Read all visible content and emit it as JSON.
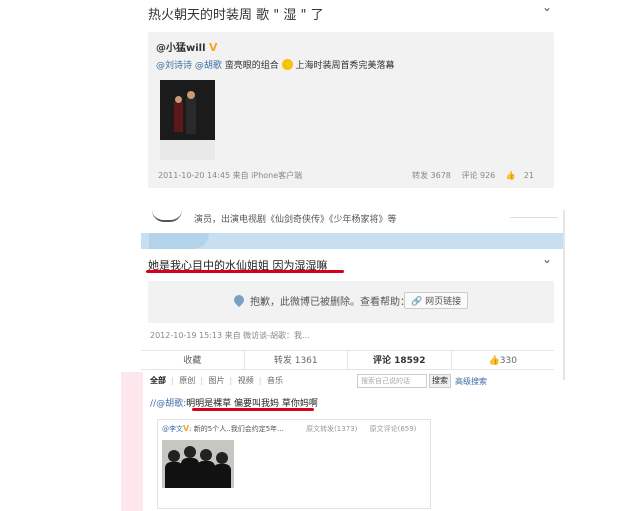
{
  "post1": {
    "text": "热火朝天的时装周 歌 \" 湿 \" 了",
    "repost": {
      "author": "@小猛will",
      "mention1": "@刘诗诗",
      "mention2": "@胡歌",
      "text_a": "蛮亮眼的组合",
      "text_b": "上海时装周首秀完美落幕",
      "time": "2011-10-20 14:45 来自 iPhone客户端",
      "forward": "转发 3678",
      "comment": "评论 926",
      "like": "21"
    }
  },
  "profile": {
    "intro": "演员，出演电视剧《仙剑奇侠传》《少年杨家将》等"
  },
  "post2": {
    "text": "她是我心目中的水仙姐姐 因为湿湿嘛",
    "deleted_notice": "抱歉，此微博已被删除。查看帮助：",
    "help_link": "网页链接",
    "time": "2012-10-19 15:13 来自 微访谈-胡歌：我...",
    "actions": {
      "favorite": "收藏",
      "forward": "转发 1361",
      "comment": "评论 18592",
      "like": "330"
    }
  },
  "comments": {
    "filters": [
      "全部",
      "原创",
      "图片",
      "视频",
      "音乐"
    ],
    "search_placeholder": "搜索自己说的话",
    "search_button": "搜索",
    "advanced": "高级搜索",
    "first_comment_prefix": "//@胡歌:",
    "first_comment_text": "明明是裸草 偏要叫我妈 草你妈啊",
    "card": {
      "author": "@李文",
      "text": "新的5个人..我们会约定5年...",
      "forward": "原文转发(1373)",
      "comment": "原文评论(659)"
    }
  }
}
